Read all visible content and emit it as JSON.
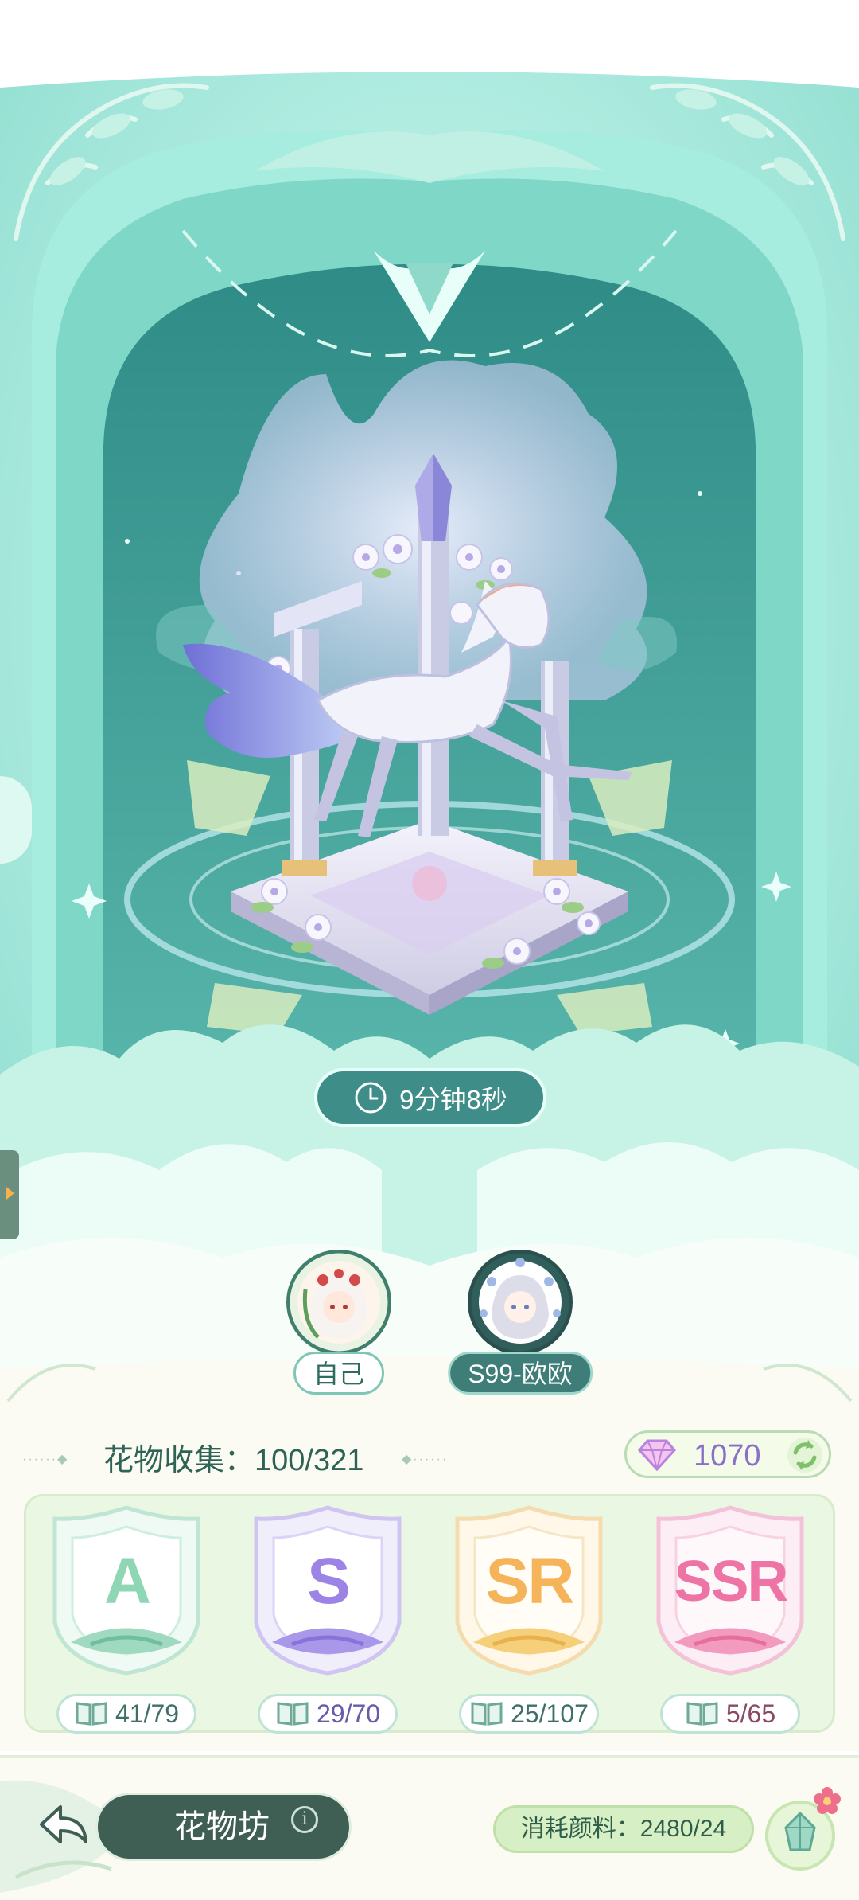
{
  "scene": {
    "timer": {
      "text": "9分钟8秒",
      "icon": "clock-icon"
    },
    "players": [
      {
        "name": "自己",
        "avatar": "self-avatar"
      },
      {
        "name": "S99-欧欧",
        "avatar": "friend-avatar"
      }
    ]
  },
  "collection": {
    "title": "花物收集：100/321",
    "gems": {
      "value": "1070",
      "icon": "diamond-icon",
      "refresh_icon": "refresh-icon"
    },
    "rarities": [
      {
        "grade": "A",
        "count": "41/79",
        "color": "#8fd6b5"
      },
      {
        "grade": "S",
        "count": "29/70",
        "color": "#9c84e6"
      },
      {
        "grade": "SR",
        "count": "25/107",
        "color": "#f5b35a"
      },
      {
        "grade": "SSR",
        "count": "5/65",
        "color": "#ee74a6"
      }
    ]
  },
  "bottom": {
    "workshop_label": "花物坊",
    "info": "i",
    "consume_text": "消耗颜料：2480/24"
  },
  "colors": {
    "teal_bg": "#8ee0d0",
    "deep_teal": "#4fa89e",
    "cream": "#fbfbf3"
  }
}
